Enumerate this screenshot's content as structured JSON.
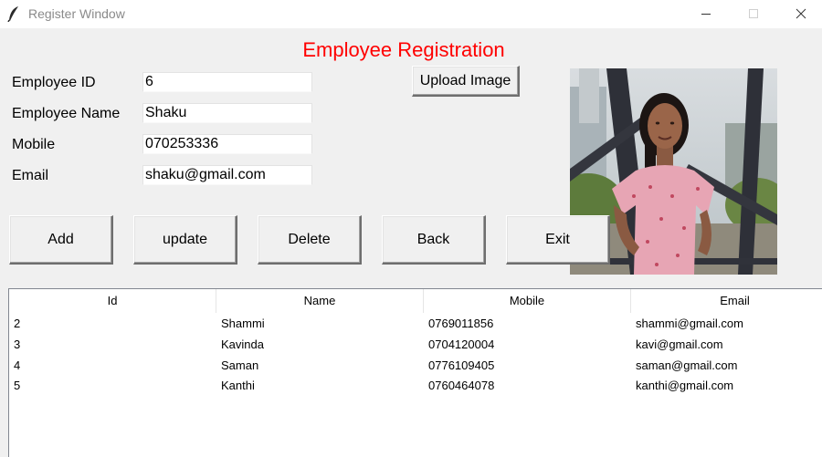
{
  "window": {
    "title": "Register Window"
  },
  "form": {
    "heading": "Employee Registration",
    "employee_id_label": "Employee ID",
    "employee_id_value": "6",
    "employee_name_label": "Employee Name",
    "employee_name_value": "Shaku",
    "mobile_label": "Mobile",
    "mobile_value": "070253336",
    "email_label": "Email",
    "email_value": "shaku@gmail.com",
    "upload_label": "Upload Image"
  },
  "actions": {
    "add_label": "Add",
    "update_label": "update",
    "delete_label": "Delete",
    "back_label": "Back",
    "exit_label": "Exit"
  },
  "table": {
    "columns": [
      "Id",
      "Name",
      "Mobile",
      "Email"
    ],
    "rows": [
      [
        "2",
        "Shammi",
        "0769011856",
        "shammi@gmail.com"
      ],
      [
        "3",
        "Kavinda",
        "0704120004",
        "kavi@gmail.com"
      ],
      [
        "4",
        "Saman",
        "0776109405",
        "saman@gmail.com"
      ],
      [
        "5",
        "Kanthi",
        "0760464078",
        "kanthi@gmail.com"
      ]
    ]
  },
  "colors": {
    "heading": "#ff0000",
    "background": "#f0f0f0"
  }
}
